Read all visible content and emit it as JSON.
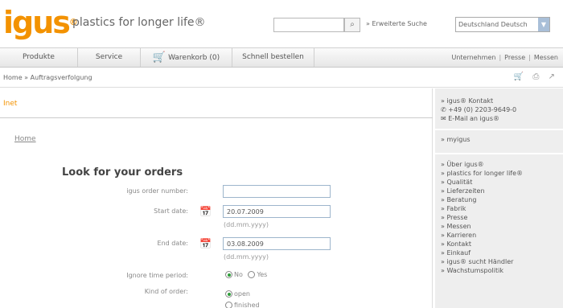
{
  "header": {
    "logo": "igus",
    "logo_mark": "®",
    "tagline": "plastics for longer life®",
    "search_placeholder": "",
    "search_icon": "search-icon",
    "advanced_search": "» Erweiterte Suche",
    "language": "Deutschland Deutsch",
    "brand_color": "#f39200"
  },
  "nav": {
    "items": [
      "Produkte",
      "Service",
      "Warenkorb (0)",
      "Schnell bestellen"
    ],
    "right": [
      "Unternehmen",
      "Presse",
      "Messen"
    ],
    "sep": "|"
  },
  "breadcrumb": "Home » Auftragsverfolgung",
  "content": {
    "section_title": "Inet",
    "home_link": "Home",
    "form_title": "Look for your orders",
    "order_label": "igus order number:",
    "order_value": "",
    "start_label": "Start date:",
    "start_value": "20.07.2009",
    "start_hint": "(dd.mm.yyyy)",
    "end_label": "End date:",
    "end_value": "03.08.2009",
    "end_hint": "(dd.mm.yyyy)",
    "ignore_label": "Ignore time period:",
    "ignore_no": "No",
    "ignore_yes": "Yes",
    "kind_label": "Kind of order:",
    "kind_open": "open",
    "kind_finished": "finished"
  },
  "sidebar": {
    "contact": [
      "» igus® Kontakt",
      "✆ +49 (0) 2203-9649-0",
      "✉ E-Mail an igus®"
    ],
    "myigus": "» myigus",
    "links": [
      "» Über igus®",
      "» plastics for longer life®",
      "» Qualität",
      "» Lieferzeiten",
      "» Beratung",
      "» Fabrik",
      "» Presse",
      "» Messen",
      "» Karrieren",
      "» Kontakt",
      "» Einkauf",
      "» igus® sucht Händler",
      "» Wachstumspolitik"
    ]
  }
}
